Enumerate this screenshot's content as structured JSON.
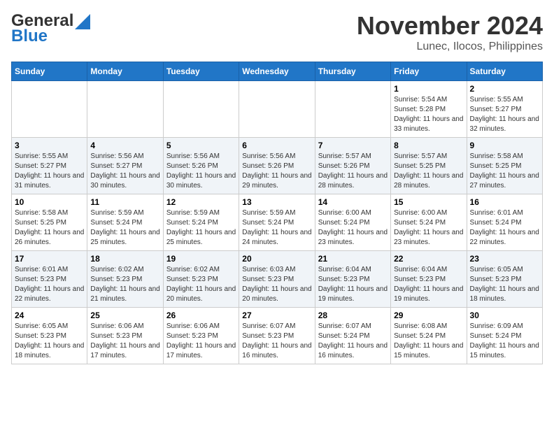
{
  "header": {
    "logo_general": "General",
    "logo_blue": "Blue",
    "month_title": "November 2024",
    "subtitle": "Lunec, Ilocos, Philippines"
  },
  "calendar": {
    "days_of_week": [
      "Sunday",
      "Monday",
      "Tuesday",
      "Wednesday",
      "Thursday",
      "Friday",
      "Saturday"
    ],
    "weeks": [
      [
        {
          "day": "",
          "info": ""
        },
        {
          "day": "",
          "info": ""
        },
        {
          "day": "",
          "info": ""
        },
        {
          "day": "",
          "info": ""
        },
        {
          "day": "",
          "info": ""
        },
        {
          "day": "1",
          "info": "Sunrise: 5:54 AM\nSunset: 5:28 PM\nDaylight: 11 hours and 33 minutes."
        },
        {
          "day": "2",
          "info": "Sunrise: 5:55 AM\nSunset: 5:27 PM\nDaylight: 11 hours and 32 minutes."
        }
      ],
      [
        {
          "day": "3",
          "info": "Sunrise: 5:55 AM\nSunset: 5:27 PM\nDaylight: 11 hours and 31 minutes."
        },
        {
          "day": "4",
          "info": "Sunrise: 5:56 AM\nSunset: 5:27 PM\nDaylight: 11 hours and 30 minutes."
        },
        {
          "day": "5",
          "info": "Sunrise: 5:56 AM\nSunset: 5:26 PM\nDaylight: 11 hours and 30 minutes."
        },
        {
          "day": "6",
          "info": "Sunrise: 5:56 AM\nSunset: 5:26 PM\nDaylight: 11 hours and 29 minutes."
        },
        {
          "day": "7",
          "info": "Sunrise: 5:57 AM\nSunset: 5:26 PM\nDaylight: 11 hours and 28 minutes."
        },
        {
          "day": "8",
          "info": "Sunrise: 5:57 AM\nSunset: 5:25 PM\nDaylight: 11 hours and 28 minutes."
        },
        {
          "day": "9",
          "info": "Sunrise: 5:58 AM\nSunset: 5:25 PM\nDaylight: 11 hours and 27 minutes."
        }
      ],
      [
        {
          "day": "10",
          "info": "Sunrise: 5:58 AM\nSunset: 5:25 PM\nDaylight: 11 hours and 26 minutes."
        },
        {
          "day": "11",
          "info": "Sunrise: 5:59 AM\nSunset: 5:24 PM\nDaylight: 11 hours and 25 minutes."
        },
        {
          "day": "12",
          "info": "Sunrise: 5:59 AM\nSunset: 5:24 PM\nDaylight: 11 hours and 25 minutes."
        },
        {
          "day": "13",
          "info": "Sunrise: 5:59 AM\nSunset: 5:24 PM\nDaylight: 11 hours and 24 minutes."
        },
        {
          "day": "14",
          "info": "Sunrise: 6:00 AM\nSunset: 5:24 PM\nDaylight: 11 hours and 23 minutes."
        },
        {
          "day": "15",
          "info": "Sunrise: 6:00 AM\nSunset: 5:24 PM\nDaylight: 11 hours and 23 minutes."
        },
        {
          "day": "16",
          "info": "Sunrise: 6:01 AM\nSunset: 5:24 PM\nDaylight: 11 hours and 22 minutes."
        }
      ],
      [
        {
          "day": "17",
          "info": "Sunrise: 6:01 AM\nSunset: 5:23 PM\nDaylight: 11 hours and 22 minutes."
        },
        {
          "day": "18",
          "info": "Sunrise: 6:02 AM\nSunset: 5:23 PM\nDaylight: 11 hours and 21 minutes."
        },
        {
          "day": "19",
          "info": "Sunrise: 6:02 AM\nSunset: 5:23 PM\nDaylight: 11 hours and 20 minutes."
        },
        {
          "day": "20",
          "info": "Sunrise: 6:03 AM\nSunset: 5:23 PM\nDaylight: 11 hours and 20 minutes."
        },
        {
          "day": "21",
          "info": "Sunrise: 6:04 AM\nSunset: 5:23 PM\nDaylight: 11 hours and 19 minutes."
        },
        {
          "day": "22",
          "info": "Sunrise: 6:04 AM\nSunset: 5:23 PM\nDaylight: 11 hours and 19 minutes."
        },
        {
          "day": "23",
          "info": "Sunrise: 6:05 AM\nSunset: 5:23 PM\nDaylight: 11 hours and 18 minutes."
        }
      ],
      [
        {
          "day": "24",
          "info": "Sunrise: 6:05 AM\nSunset: 5:23 PM\nDaylight: 11 hours and 18 minutes."
        },
        {
          "day": "25",
          "info": "Sunrise: 6:06 AM\nSunset: 5:23 PM\nDaylight: 11 hours and 17 minutes."
        },
        {
          "day": "26",
          "info": "Sunrise: 6:06 AM\nSunset: 5:23 PM\nDaylight: 11 hours and 17 minutes."
        },
        {
          "day": "27",
          "info": "Sunrise: 6:07 AM\nSunset: 5:23 PM\nDaylight: 11 hours and 16 minutes."
        },
        {
          "day": "28",
          "info": "Sunrise: 6:07 AM\nSunset: 5:24 PM\nDaylight: 11 hours and 16 minutes."
        },
        {
          "day": "29",
          "info": "Sunrise: 6:08 AM\nSunset: 5:24 PM\nDaylight: 11 hours and 15 minutes."
        },
        {
          "day": "30",
          "info": "Sunrise: 6:09 AM\nSunset: 5:24 PM\nDaylight: 11 hours and 15 minutes."
        }
      ]
    ]
  }
}
